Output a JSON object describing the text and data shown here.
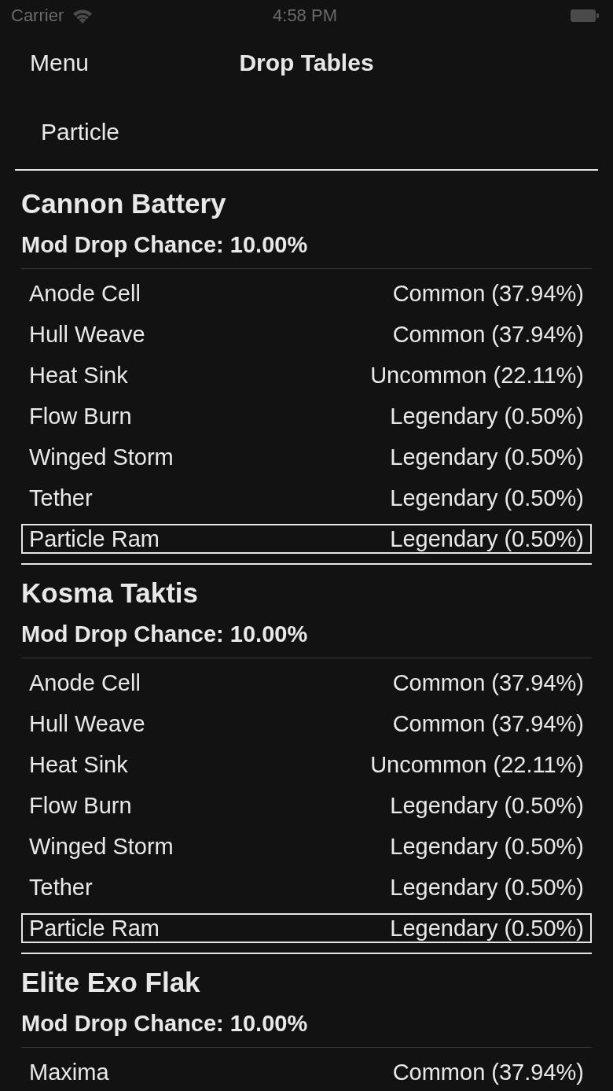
{
  "status_bar": {
    "carrier": "Carrier",
    "time": "4:58 PM"
  },
  "nav_bar": {
    "back_button": "Menu",
    "title": "Drop Tables"
  },
  "filter": {
    "label": "Particle"
  },
  "sections": [
    {
      "title": "Cannon Battery",
      "mod_drop_chance": "Mod Drop Chance: 10.00%",
      "rows": [
        {
          "name": "Anode Cell",
          "rarity": "Common (37.94%)",
          "highlighted": false
        },
        {
          "name": "Hull Weave",
          "rarity": "Common (37.94%)",
          "highlighted": false
        },
        {
          "name": "Heat Sink",
          "rarity": "Uncommon (22.11%)",
          "highlighted": false
        },
        {
          "name": "Flow Burn",
          "rarity": "Legendary (0.50%)",
          "highlighted": false
        },
        {
          "name": "Winged Storm",
          "rarity": "Legendary (0.50%)",
          "highlighted": false
        },
        {
          "name": "Tether",
          "rarity": "Legendary (0.50%)",
          "highlighted": false
        },
        {
          "name": "Particle Ram",
          "rarity": "Legendary (0.50%)",
          "highlighted": true
        }
      ]
    },
    {
      "title": "Kosma Taktis",
      "mod_drop_chance": "Mod Drop Chance: 10.00%",
      "rows": [
        {
          "name": "Anode Cell",
          "rarity": "Common (37.94%)",
          "highlighted": false
        },
        {
          "name": "Hull Weave",
          "rarity": "Common (37.94%)",
          "highlighted": false
        },
        {
          "name": "Heat Sink",
          "rarity": "Uncommon (22.11%)",
          "highlighted": false
        },
        {
          "name": "Flow Burn",
          "rarity": "Legendary (0.50%)",
          "highlighted": false
        },
        {
          "name": "Winged Storm",
          "rarity": "Legendary (0.50%)",
          "highlighted": false
        },
        {
          "name": "Tether",
          "rarity": "Legendary (0.50%)",
          "highlighted": false
        },
        {
          "name": "Particle Ram",
          "rarity": "Legendary (0.50%)",
          "highlighted": true
        }
      ]
    },
    {
      "title": "Elite Exo Flak",
      "mod_drop_chance": "Mod Drop Chance: 10.00%",
      "rows": [
        {
          "name": "Maxima",
          "rarity": "Common (37.94%)",
          "highlighted": false
        }
      ]
    }
  ]
}
